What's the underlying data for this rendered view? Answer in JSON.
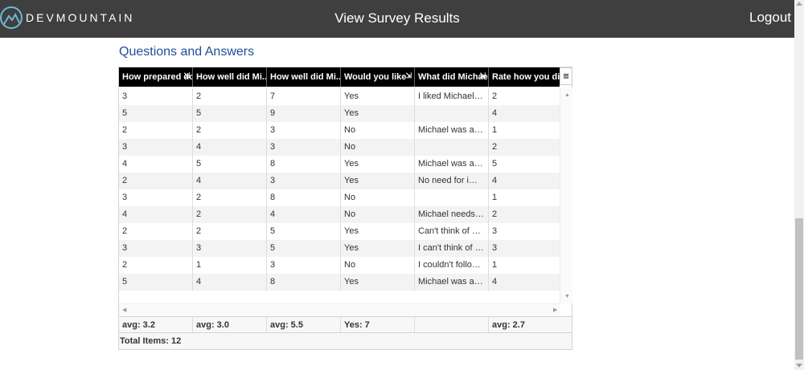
{
  "header": {
    "brand": "DEVMOUNTAIN",
    "title": "View Survey Results",
    "logout_label": "Logout"
  },
  "section_title": "Questions and Answers",
  "grid": {
    "columns": [
      "How prepared do...",
      "How well did Mi...",
      "How well did Mi...",
      "Would you like",
      "What did Michael...",
      "Rate how you di..."
    ],
    "rows": [
      [
        "3",
        "2",
        "7",
        "Yes",
        "I liked Michael. ...",
        "2"
      ],
      [
        "5",
        "5",
        "9",
        "Yes",
        "",
        "4"
      ],
      [
        "2",
        "2",
        "3",
        "No",
        "Michael was a t...",
        "1"
      ],
      [
        "3",
        "4",
        "3",
        "No",
        "",
        "2"
      ],
      [
        "4",
        "5",
        "8",
        "Yes",
        "Michael was a f...",
        "5"
      ],
      [
        "2",
        "4",
        "3",
        "Yes",
        "No need for imp...",
        "4"
      ],
      [
        "3",
        "2",
        "8",
        "No",
        "",
        "1"
      ],
      [
        "4",
        "2",
        "4",
        "No",
        "Michael needs t...",
        "2"
      ],
      [
        "2",
        "2",
        "5",
        "Yes",
        "Can't think of an...",
        "3"
      ],
      [
        "3",
        "3",
        "5",
        "Yes",
        "I can't think of a...",
        "3"
      ],
      [
        "2",
        "1",
        "3",
        "No",
        "I couldn't follow...",
        "1"
      ],
      [
        "5",
        "4",
        "8",
        "Yes",
        "Michael was aw...",
        "4"
      ]
    ],
    "footer": [
      "avg: 3.2",
      "avg: 3.0",
      "avg: 5.5",
      "Yes: 7",
      "",
      "avg: 2.7"
    ],
    "total_items": "Total Items: 12"
  },
  "colors": {
    "topbar": "#3f3f3f",
    "section_title": "#1f4e9b",
    "grid_header": "#000000"
  },
  "icons": {
    "brand": "mountain-logo-icon",
    "grid_menu": "hamburger-menu-icon",
    "sort": "sort-arrow-icon"
  }
}
